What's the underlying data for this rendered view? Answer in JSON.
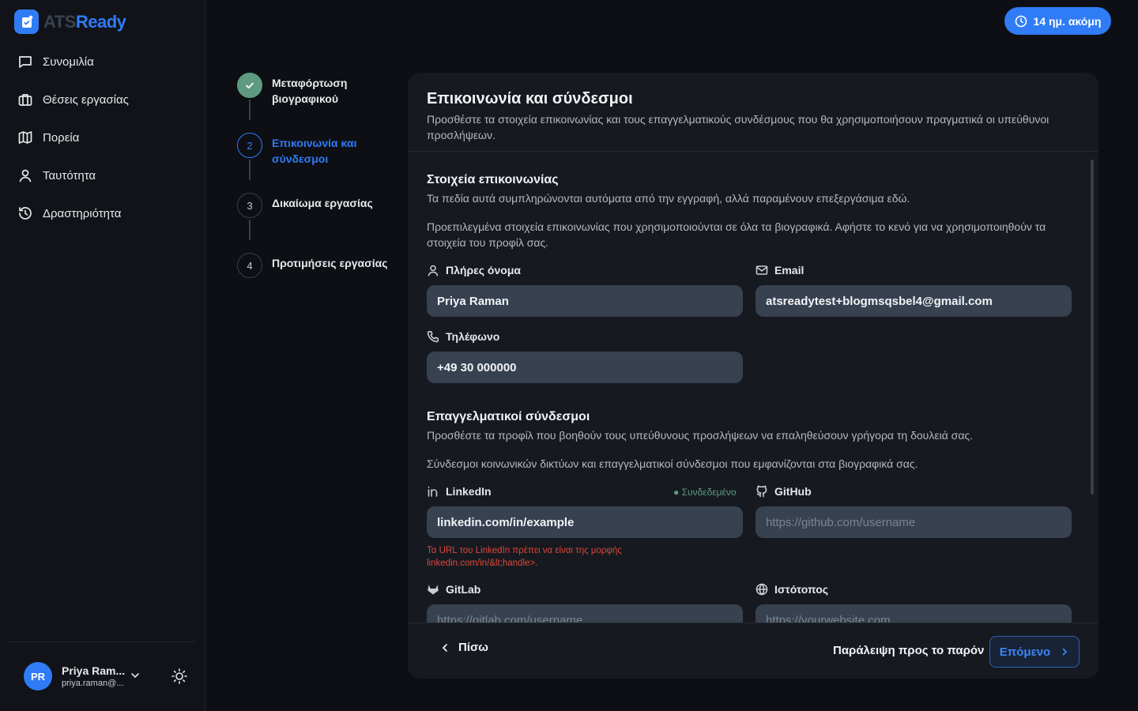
{
  "brand": {
    "name_part1": "ATS",
    "name_part2": "Ready"
  },
  "sidebar": {
    "items": [
      {
        "label": "Συνομιλία",
        "icon": "chat-icon"
      },
      {
        "label": "Θέσεις εργασίας",
        "icon": "briefcase-icon"
      },
      {
        "label": "Πορεία",
        "icon": "map-icon"
      },
      {
        "label": "Ταυτότητα",
        "icon": "user-icon"
      },
      {
        "label": "Δραστηριότητα",
        "icon": "history-icon"
      }
    ],
    "user": {
      "initials": "PR",
      "name": "Priya Ram...",
      "email": "priya.raman@..."
    }
  },
  "trial": {
    "label": "14 ημ. ακόμη"
  },
  "stepper": {
    "steps": [
      {
        "number": "",
        "label": "Μεταφόρτωση βιογραφικού",
        "state": "done"
      },
      {
        "number": "2",
        "label": "Επικοινωνία και σύνδεσμοι",
        "state": "active"
      },
      {
        "number": "3",
        "label": "Δικαίωμα εργασίας",
        "state": "pending"
      },
      {
        "number": "4",
        "label": "Προτιμήσεις εργασίας",
        "state": "pending"
      }
    ]
  },
  "card": {
    "title": "Επικοινωνία και σύνδεσμοι",
    "subtitle": "Προσθέστε τα στοιχεία επικοινωνίας και τους επαγγελματικούς συνδέσμους που θα χρησιμοποιήσουν πραγματικά οι υπεύθυνοι προσλήψεων.",
    "contact": {
      "title": "Στοιχεία επικοινωνίας",
      "desc1": "Τα πεδία αυτά συμπληρώνονται αυτόματα από την εγγραφή, αλλά παραμένουν επεξεργάσιμα εδώ.",
      "desc2": "Προεπιλεγμένα στοιχεία επικοινωνίας που χρησιμοποιούνται σε όλα τα βιογραφικά. Αφήστε το κενό για να χρησιμοποιηθούν τα στοιχεία του προφίλ σας.",
      "fullname_label": "Πλήρες όνομα",
      "fullname_value": "Priya Raman",
      "email_label": "Email",
      "email_value": "atsreadytest+blogmsqsbel4@gmail.com",
      "phone_label": "Τηλέφωνο",
      "phone_value": "+49 30 000000"
    },
    "links": {
      "title": "Επαγγελματικοί σύνδεσμοι",
      "desc1": "Προσθέστε τα προφίλ που βοηθούν τους υπεύθυνους προσλήψεων να επαληθεύσουν γρήγορα τη δουλειά σας.",
      "desc2": "Σύνδεσμοι κοινωνικών δικτύων και επαγγελματικοί σύνδεσμοι που εμφανίζονται στα βιογραφικά σας.",
      "linkedin_label": "LinkedIn",
      "linkedin_status": "● Συνδεδεμένο",
      "linkedin_value": "linkedin.com/in/example",
      "linkedin_error": "Τα URL του LinkedIn πρέπει να είναι της μορφής linkedin.com/in/&lt;handle>.",
      "github_label": "GitHub",
      "github_placeholder": "https://github.com/username",
      "gitlab_label": "GitLab",
      "gitlab_placeholder": "https://gitlab.com/username",
      "website_label": "Ιστότοπος",
      "website_placeholder": "https://yourwebsite.com"
    },
    "footer": {
      "back": "Πίσω",
      "skip": "Παράλειψη προς το παρόν",
      "next": "Επόμενο"
    }
  },
  "colors": {
    "accent": "#2f7cf6",
    "done": "#5e9a80",
    "error": "#e0453a",
    "input_bg": "#374150"
  }
}
